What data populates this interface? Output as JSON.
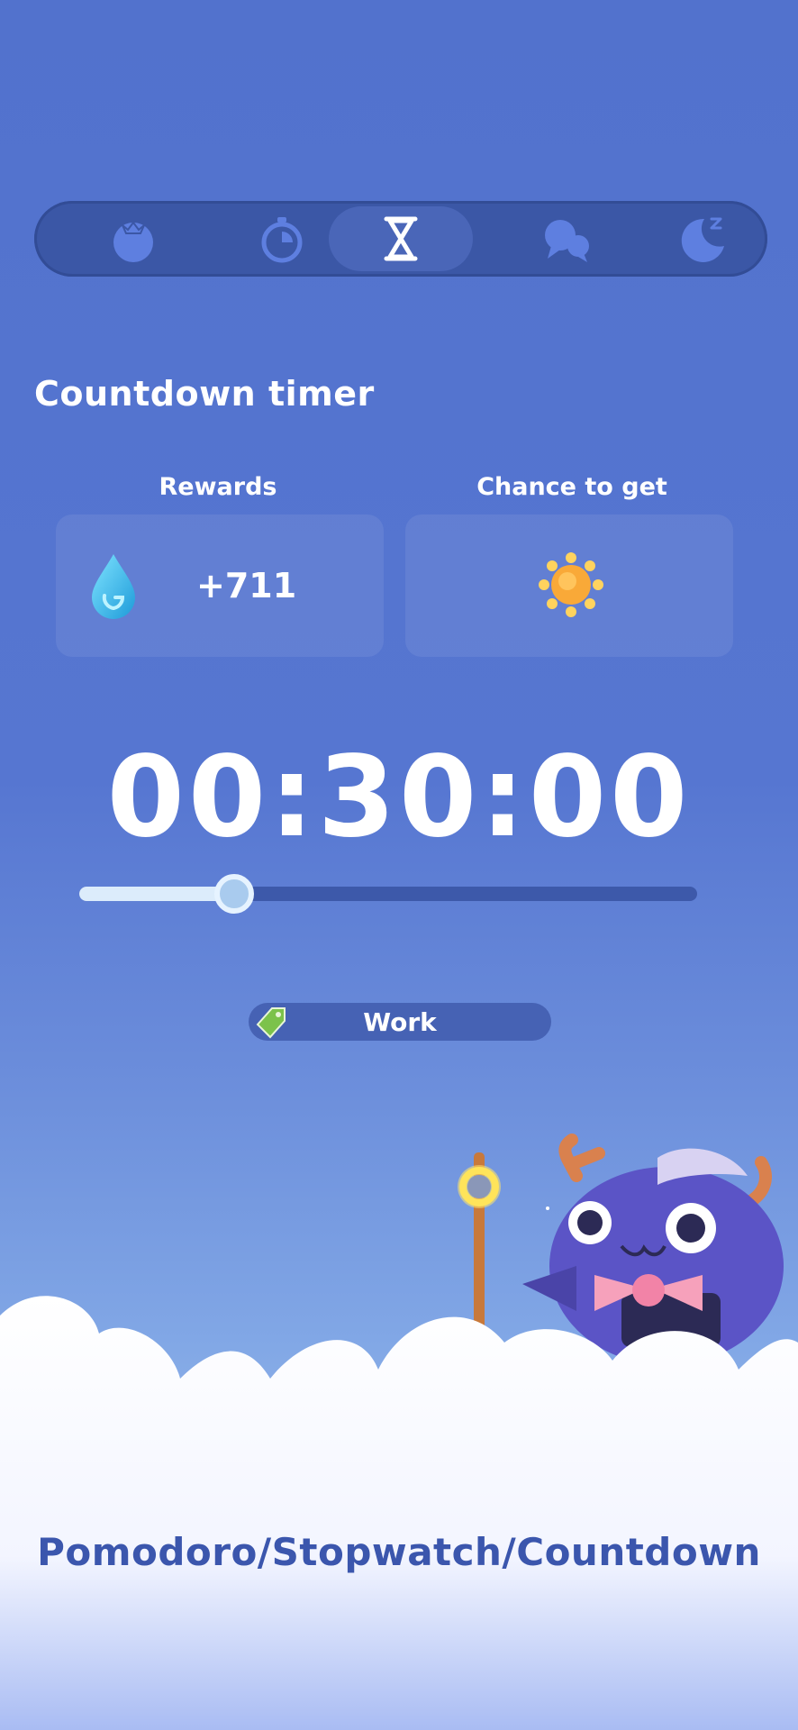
{
  "modes": [
    {
      "icon": "tomato-icon",
      "active": false
    },
    {
      "icon": "stopwatch-icon",
      "active": false
    },
    {
      "icon": "hourglass-icon",
      "active": true
    },
    {
      "icon": "chat-icon",
      "active": false
    },
    {
      "icon": "moon-icon",
      "active": false
    }
  ],
  "page": {
    "title": "Countdown timer"
  },
  "rewards": {
    "label": "Rewards",
    "icon": "water-drop-icon",
    "value": "+711"
  },
  "chance": {
    "label": "Chance to get",
    "icon": "sun-icon"
  },
  "timer": {
    "display": "00:30:00",
    "progress": 0.25
  },
  "tag": {
    "label": "Work",
    "icon": "tag-icon",
    "color": "#7cc24b"
  },
  "footer": {
    "text": "Pomodoro/Stopwatch/Countdown"
  },
  "colors": {
    "accent": "#5272cd",
    "footer_text": "#3b56ad"
  }
}
